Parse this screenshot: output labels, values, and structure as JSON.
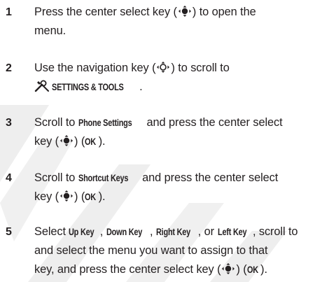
{
  "steps": [
    {
      "number": "1",
      "parts": [
        "Press the center select key (",
        ") to open the",
        "menu."
      ]
    },
    {
      "number": "2",
      "parts": [
        "Use the navigation key (",
        ") to scroll to"
      ],
      "menu_name": "SETTINGS & TOOLS",
      "menu_suffix": "."
    },
    {
      "number": "3",
      "parts": [
        "Scroll to ",
        " and press the center select",
        "key (",
        ") (",
        ")."
      ],
      "bold": [
        "Phone Settings",
        "OK"
      ]
    },
    {
      "number": "4",
      "parts": [
        "Scroll to ",
        " and press the center select",
        "key (",
        ") (",
        ")."
      ],
      "bold": [
        "Shortcut Keys",
        "OK"
      ]
    },
    {
      "number": "5",
      "parts": [
        "Select ",
        ", ",
        ", ",
        ", or ",
        ", scroll to",
        "and select the menu you want to assign to that",
        "key, and press the center select key (",
        ") (",
        ")."
      ],
      "bold": [
        "Up Key",
        "Down Key",
        "Right Key",
        "Left Key",
        "OK"
      ]
    }
  ],
  "icons": {
    "select_key": "center-select-key-icon",
    "nav_key": "navigation-key-icon",
    "tools": "settings-tools-icon"
  },
  "colors": {
    "text": "#231f20",
    "watermark": "#ededed"
  }
}
